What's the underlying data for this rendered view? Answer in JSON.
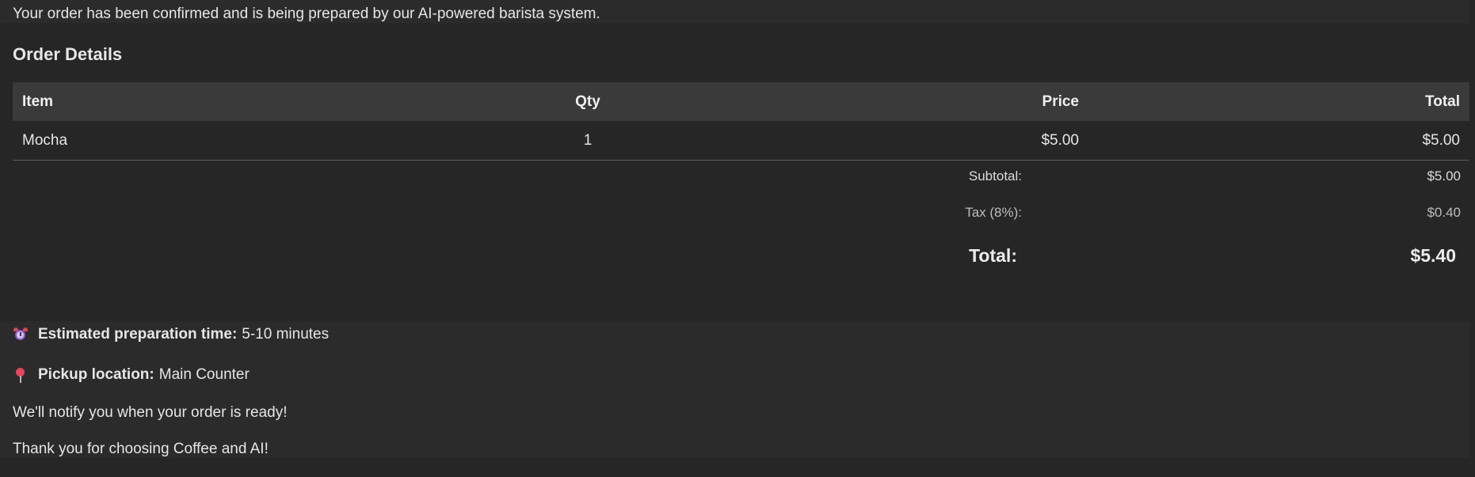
{
  "banner": {
    "text": "Your order has been confirmed and is being prepared by our AI-powered barista system."
  },
  "order": {
    "title": "Order Details",
    "columns": {
      "item": "Item",
      "qty": "Qty",
      "price": "Price",
      "total": "Total"
    },
    "rows": [
      {
        "item": "Mocha",
        "qty": "1",
        "price": "$5.00",
        "total": "$5.00"
      }
    ],
    "subtotal_label": "Subtotal:",
    "subtotal_value": "$5.00",
    "tax_label": "Tax (8%):",
    "tax_value": "$0.40",
    "total_label": "Total:",
    "total_value": "$5.40"
  },
  "info": {
    "prep_icon": "alarm-clock-icon",
    "prep_label": "Estimated preparation time:",
    "prep_value": "5-10 minutes",
    "pickup_icon": "pushpin-icon",
    "pickup_label": "Pickup location:",
    "pickup_value": "Main Counter",
    "notify_text": "We'll notify you when your order is ready!",
    "thanks_text": "Thank you for choosing Coffee and AI!"
  }
}
